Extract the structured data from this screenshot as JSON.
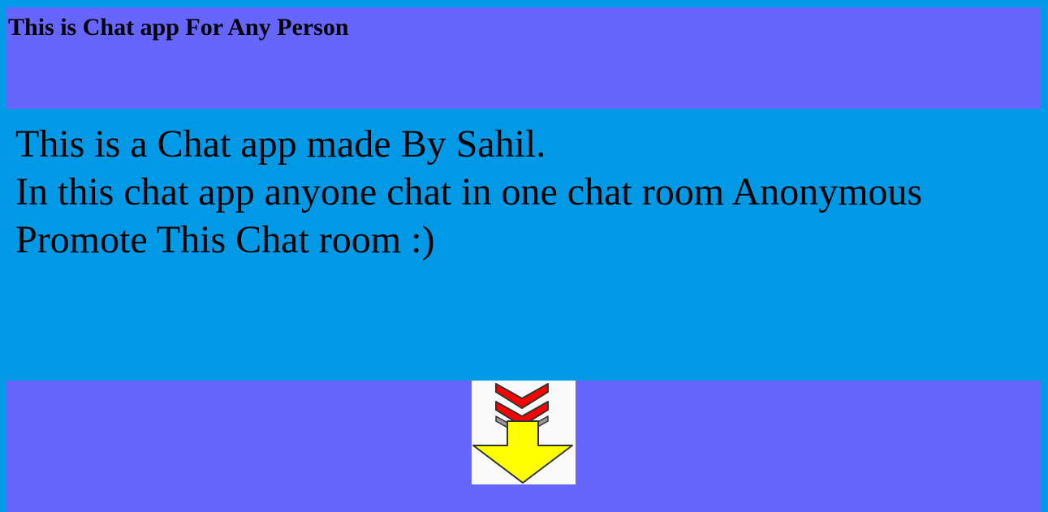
{
  "header": {
    "title": "This is Chat app For Any Person"
  },
  "intro": {
    "lines": [
      "This is a Chat app made By Sahil.",
      "In this chat app anyone chat in one chat room Anonymous",
      "Promote This Chat room :)"
    ]
  },
  "footer": {
    "button_icon": "down-arrow-icon"
  },
  "colors": {
    "page_background": "#0099e5",
    "panel_background": "#6666ff",
    "arrow_red": "#ff0000",
    "arrow_yellow": "#ffff00"
  }
}
